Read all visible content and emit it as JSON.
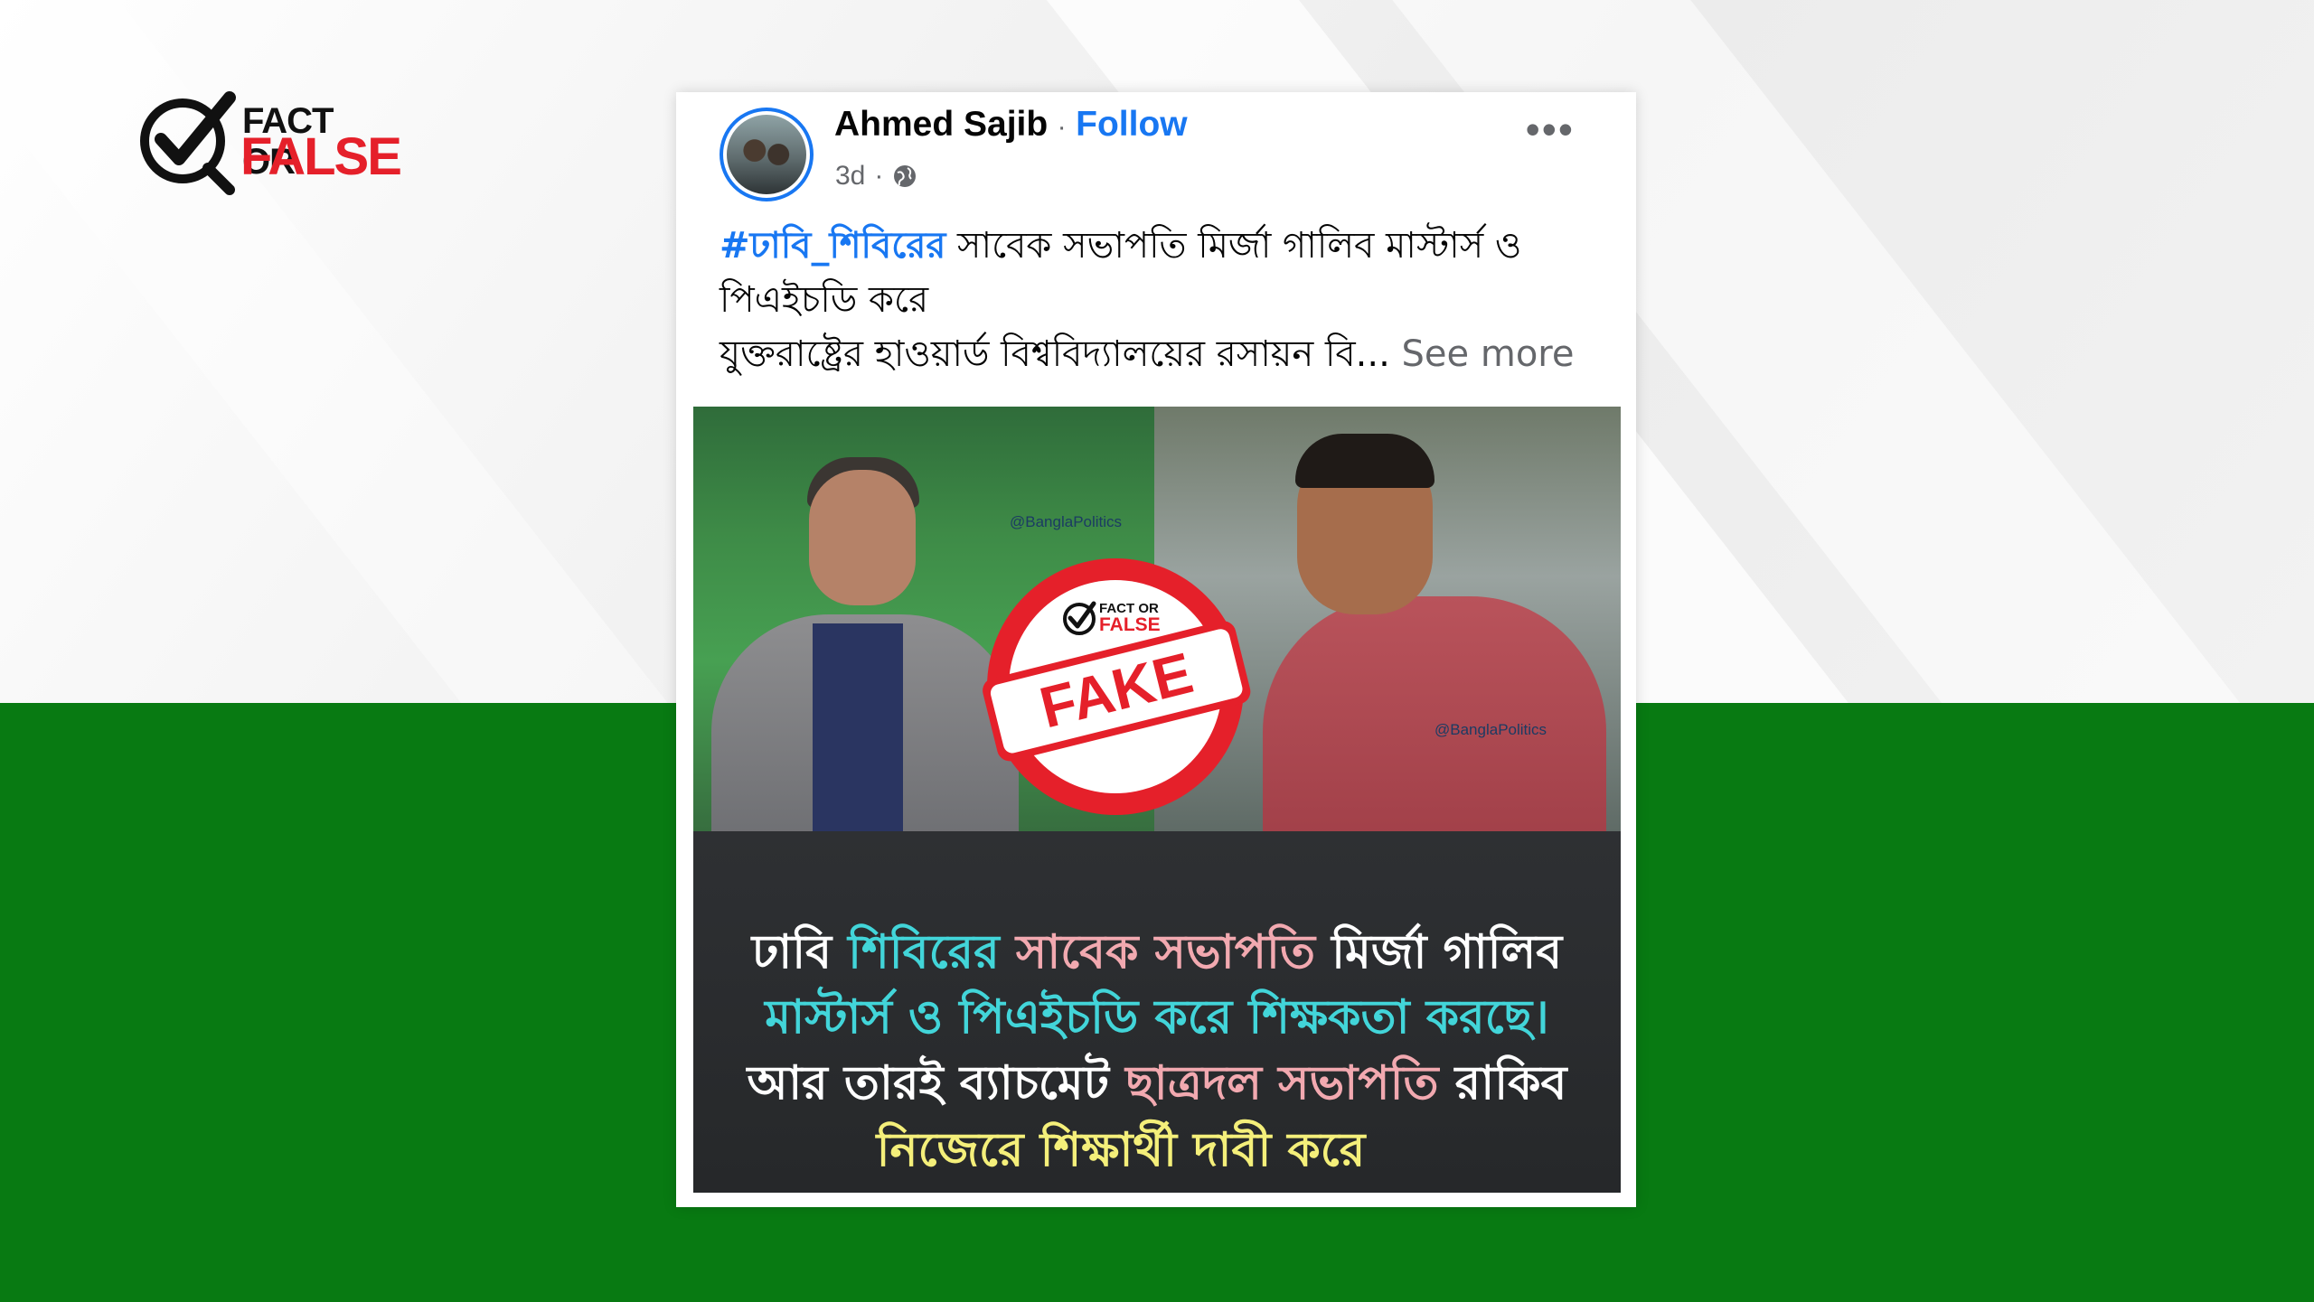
{
  "brand": {
    "logo_line1": "FACT OR",
    "logo_line2": "FALSE",
    "red": "#e5202a",
    "green_band": "#087a12"
  },
  "post": {
    "author": "Ahmed Sajib",
    "separator": "·",
    "follow_label": "Follow",
    "time": "3d",
    "meta_separator": "·",
    "audience_icon": "globe-icon",
    "more_icon": "more-options-icon",
    "more_label": "•••",
    "hashtag": "#ঢাবি_শিবিরের",
    "text_line1_rest": " সাবেক সভাপতি মির্জা গালিব মাস্টার্স ও",
    "text_line2": "পিএইচডি করে",
    "text_line3": "যুক্তরাষ্ট্রের হাওয়ার্ড বিশ্ববিদ্যালয়ের রসায়ন বি...",
    "see_more": "See more",
    "link_color": "#1877f2"
  },
  "image": {
    "watermark": "@BanglaPolitics",
    "caption_line1_a": "ঢাবি ",
    "caption_line1_b": "শিবিরের",
    "caption_line1_c": " সাবেক সভাপতি ",
    "caption_line1_d": "মির্জা গালিব",
    "caption_line2": "মাস্টার্স ও পিএইচডি করে শিক্ষকতা করছে।",
    "caption_line3_a": "আর তারই ব্যাচমেট ",
    "caption_line3_b": "ছাত্রদল সভাপতি",
    "caption_line3_c": " রাকিব",
    "caption_line4": "নিজেরে শিক্ষার্থী দাবী করে"
  },
  "stamp": {
    "label": "FAKE",
    "mini_logo_line1": "FACT OR",
    "mini_logo_line2": "FALSE"
  }
}
